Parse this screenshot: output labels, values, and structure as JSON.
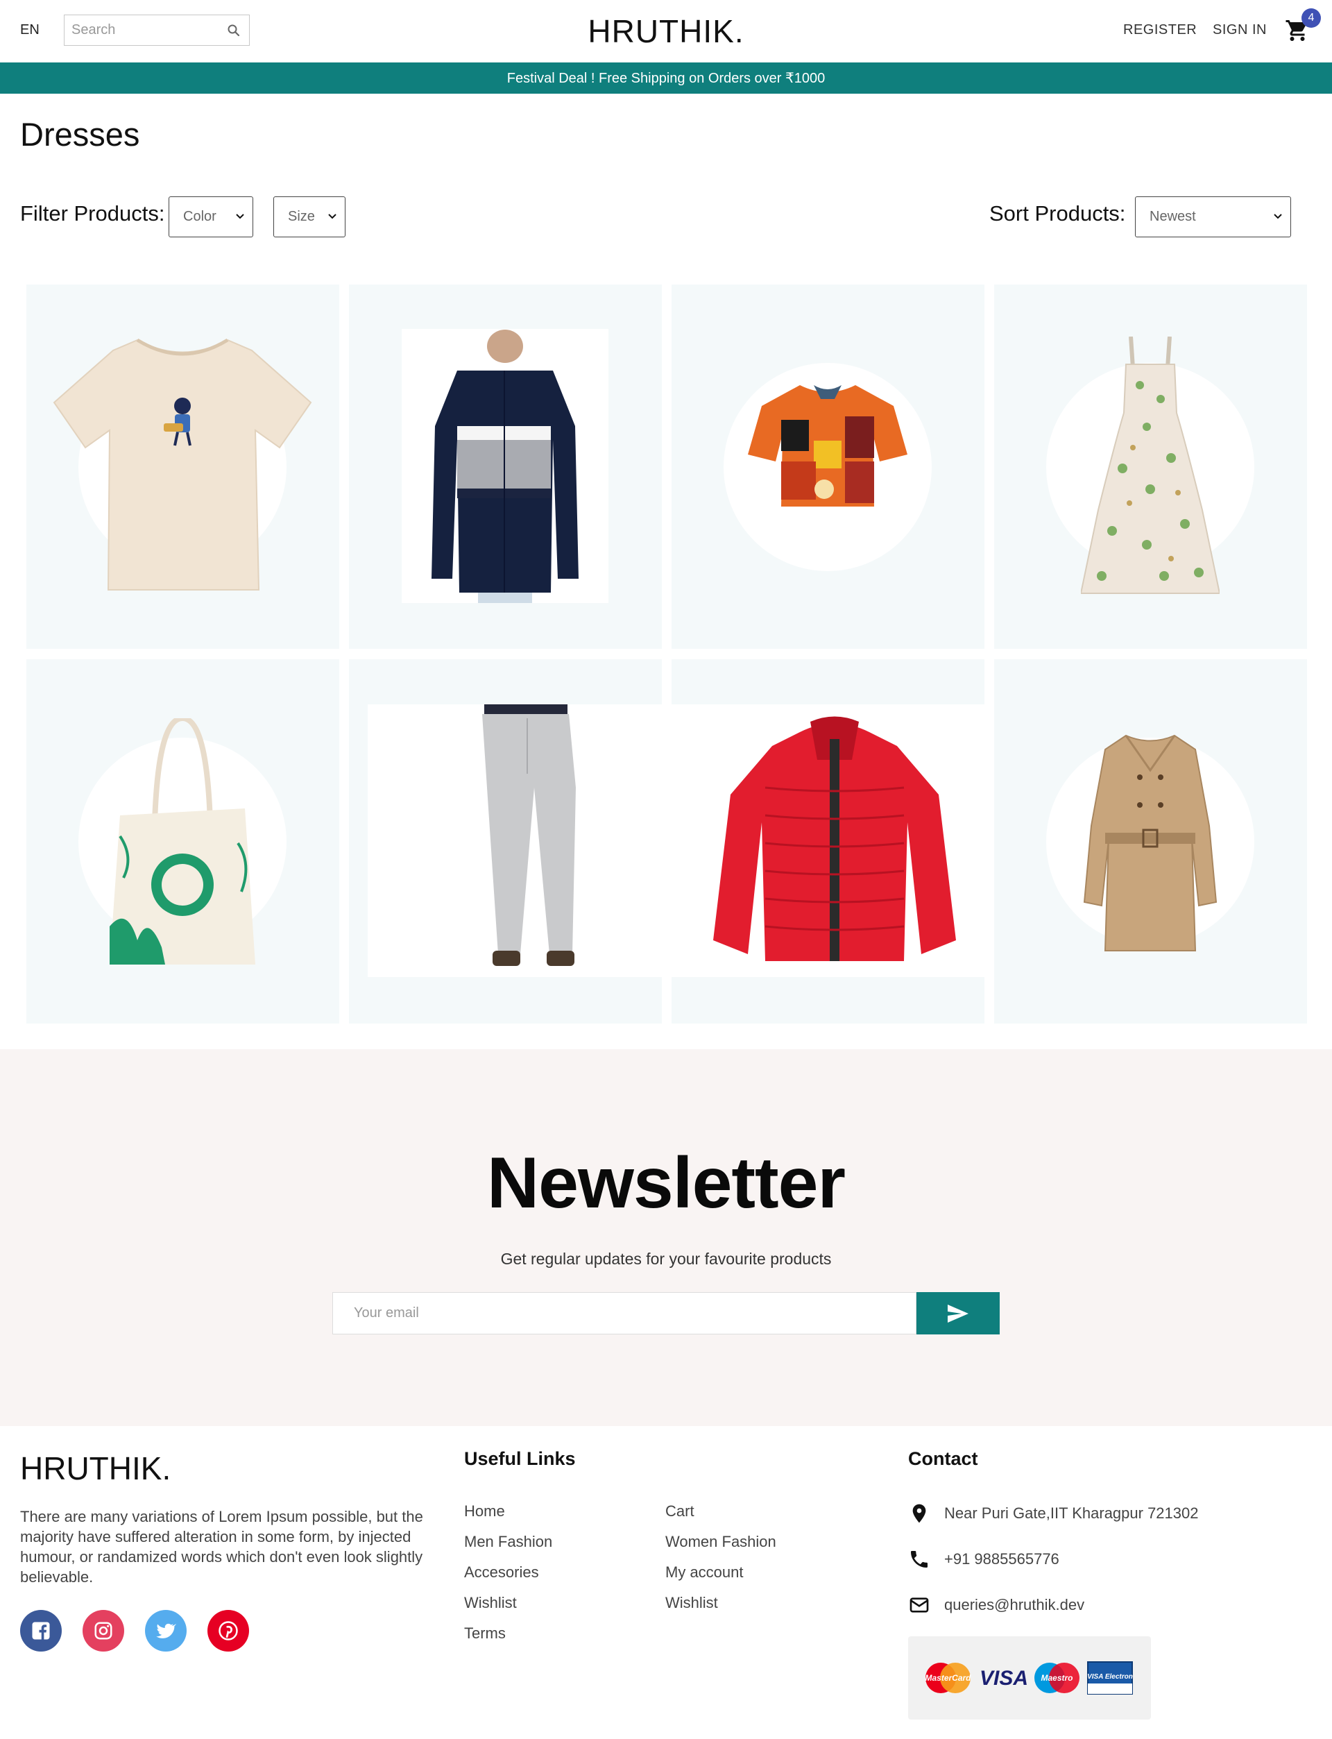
{
  "nav": {
    "lang": "EN",
    "search_placeholder": "Search",
    "logo": "HRUTHIK.",
    "register": "REGISTER",
    "signin": "SIGN IN",
    "cart_count": "4"
  },
  "announcement": "Festival Deal ! Free Shipping on Orders over ₹1000",
  "page_title": "Dresses",
  "filters": {
    "label": "Filter Products:",
    "color": "Color",
    "size": "Size"
  },
  "sort": {
    "label": "Sort Products:",
    "selected": "Newest"
  },
  "products": [
    {
      "name": "tshirt"
    },
    {
      "name": "striped-shirt"
    },
    {
      "name": "printed-shirt"
    },
    {
      "name": "floral-dress"
    },
    {
      "name": "tote-bag"
    },
    {
      "name": "grey-pants"
    },
    {
      "name": "red-puffer-jacket"
    },
    {
      "name": "trench-coat"
    }
  ],
  "newsletter": {
    "title": "Newsletter",
    "subtitle": "Get regular updates for your favourite products",
    "placeholder": "Your email"
  },
  "footer": {
    "logo": "HRUTHIK.",
    "description": "There are many variations of Lorem Ipsum possible, but the majority have suffered alteration in some form, by injected humour, or randamized words which don't even look slightly believable.",
    "links_title": "Useful Links",
    "links_col1": [
      "Home",
      "Men Fashion",
      "Accesories",
      "Wishlist",
      "Terms"
    ],
    "links_col2": [
      "Cart",
      "Women Fashion",
      "My account",
      "Wishlist"
    ],
    "contact_title": "Contact",
    "address": "Near Puri Gate,IIT Kharagpur 721302",
    "phone": "+91 9885565776",
    "email": "queries@hruthik.dev",
    "payment": [
      "MasterCard",
      "VISA",
      "Maestro",
      "VISA Electron"
    ]
  },
  "colors": {
    "accent": "#0f7f7d",
    "badge": "#3f51b5",
    "card_bg": "#f4f9fa",
    "newsletter_bg": "#f9f4f3"
  }
}
